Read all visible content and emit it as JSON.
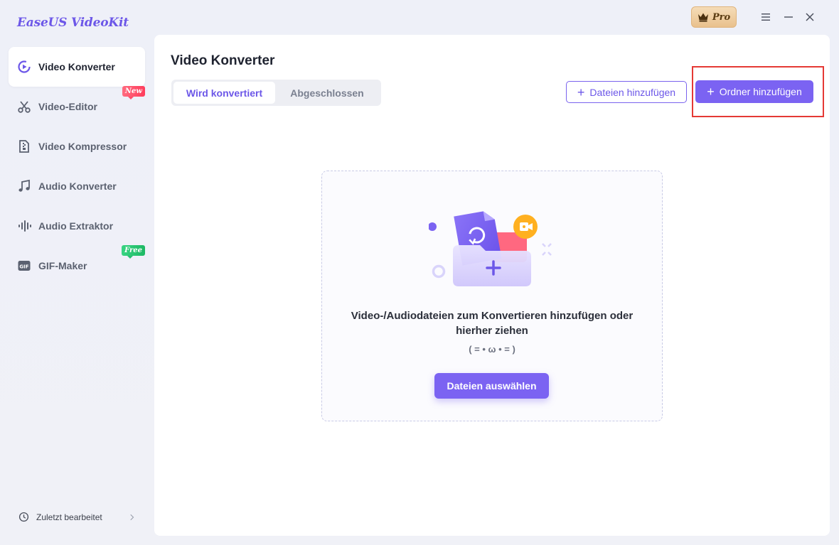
{
  "app": {
    "title": "EaseUS VideoKit",
    "pro_label": "Pro"
  },
  "colors": {
    "accent": "#7b63f2",
    "highlight": "#e53935",
    "new_tag": "#ff4d6a",
    "free_tag": "#26c070"
  },
  "sidebar": {
    "items": [
      {
        "label": "Video Konverter",
        "icon": "video-converter-icon",
        "active": true
      },
      {
        "label": "Video-Editor",
        "icon": "scissors-icon",
        "tag": "New"
      },
      {
        "label": "Video Kompressor",
        "icon": "compress-icon"
      },
      {
        "label": "Audio Konverter",
        "icon": "music-note-icon"
      },
      {
        "label": "Audio Extraktor",
        "icon": "audio-wave-icon"
      },
      {
        "label": "GIF-Maker",
        "icon": "gif-icon",
        "tag": "Free"
      }
    ],
    "recent_label": "Zuletzt bearbeitet"
  },
  "main": {
    "title": "Video Konverter",
    "tabs": [
      {
        "label": "Wird konvertiert",
        "active": true
      },
      {
        "label": "Abgeschlossen",
        "active": false
      }
    ],
    "add_files_label": "Dateien hinzufügen",
    "add_folder_label": "Ordner hinzufügen",
    "dropzone": {
      "text": "Video-/Audiodateien zum Konvertieren hinzufügen oder hierher ziehen",
      "kaomoji": "( = • ω • = )",
      "select_button": "Dateien auswählen"
    }
  }
}
